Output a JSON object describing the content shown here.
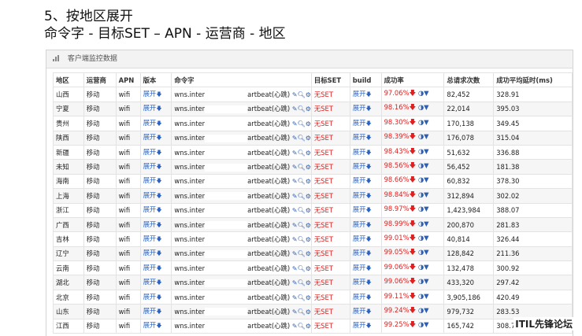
{
  "heading": {
    "line1": "5、按地区展开",
    "line2": "命令字 - 目标SET – APN - 运营商 - 地区"
  },
  "panel": {
    "title": "客户端监控数据"
  },
  "table": {
    "headers": [
      "地区",
      "运营商",
      "APN",
      "版本",
      "命令字",
      "目标SET",
      "build",
      "成功率",
      "总请求次数",
      "成功平均延时(ms)"
    ],
    "rows": [
      {
        "region": "山西",
        "carrier": "移动",
        "apn": "wifi",
        "version": "展开",
        "cmd_prefix": "wns.inter",
        "cmd_suffix": "artbeat(心跳)",
        "target_set": "无SET",
        "build": "展开",
        "rate": "97.06%",
        "total": "82,452",
        "latency": "328.91"
      },
      {
        "region": "宁夏",
        "carrier": "移动",
        "apn": "wifi",
        "version": "展开",
        "cmd_prefix": "wns.inter",
        "cmd_suffix": "artbeat(心跳)",
        "target_set": "无SET",
        "build": "展开",
        "rate": "98.16%",
        "total": "22,014",
        "latency": "395.03"
      },
      {
        "region": "贵州",
        "carrier": "移动",
        "apn": "wifi",
        "version": "展开",
        "cmd_prefix": "wns.inter",
        "cmd_suffix": "artbeat(心跳)",
        "target_set": "无SET",
        "build": "展开",
        "rate": "98.30%",
        "total": "170,138",
        "latency": "349.45"
      },
      {
        "region": "陕西",
        "carrier": "移动",
        "apn": "wifi",
        "version": "展开",
        "cmd_prefix": "wns.inter",
        "cmd_suffix": "artbeat(心跳)",
        "target_set": "无SET",
        "build": "展开",
        "rate": "98.39%",
        "total": "176,078",
        "latency": "315.04"
      },
      {
        "region": "新疆",
        "carrier": "移动",
        "apn": "wifi",
        "version": "展开",
        "cmd_prefix": "wns.inter",
        "cmd_suffix": "artbeat(心跳)",
        "target_set": "无SET",
        "build": "展开",
        "rate": "98.43%",
        "total": "51,632",
        "latency": "336.88"
      },
      {
        "region": "未知",
        "carrier": "移动",
        "apn": "wifi",
        "version": "展开",
        "cmd_prefix": "wns.inter",
        "cmd_suffix": "artbeat(心跳)",
        "target_set": "无SET",
        "build": "展开",
        "rate": "98.56%",
        "total": "56,452",
        "latency": "181.38"
      },
      {
        "region": "海南",
        "carrier": "移动",
        "apn": "wifi",
        "version": "展开",
        "cmd_prefix": "wns.inter",
        "cmd_suffix": "artbeat(心跳)",
        "target_set": "无SET",
        "build": "展开",
        "rate": "98.66%",
        "total": "60,832",
        "latency": "378.30"
      },
      {
        "region": "上海",
        "carrier": "移动",
        "apn": "wifi",
        "version": "展开",
        "cmd_prefix": "wns.inter",
        "cmd_suffix": "artbeat(心跳)",
        "target_set": "无SET",
        "build": "展开",
        "rate": "98.84%",
        "total": "312,894",
        "latency": "302.02"
      },
      {
        "region": "浙江",
        "carrier": "移动",
        "apn": "wifi",
        "version": "展开",
        "cmd_prefix": "wns.inter",
        "cmd_suffix": "artbeat(心跳)",
        "target_set": "无SET",
        "build": "展开",
        "rate": "98.97%",
        "total": "1,423,984",
        "latency": "388.07"
      },
      {
        "region": "广西",
        "carrier": "移动",
        "apn": "wifi",
        "version": "展开",
        "cmd_prefix": "wns.inter",
        "cmd_suffix": "artbeat(心跳)",
        "target_set": "无SET",
        "build": "展开",
        "rate": "98.99%",
        "total": "200,870",
        "latency": "281.83"
      },
      {
        "region": "吉林",
        "carrier": "移动",
        "apn": "wifi",
        "version": "展开",
        "cmd_prefix": "wns.inter",
        "cmd_suffix": "artbeat(心跳)",
        "target_set": "无SET",
        "build": "展开",
        "rate": "99.01%",
        "total": "40,814",
        "latency": "326.44"
      },
      {
        "region": "辽宁",
        "carrier": "移动",
        "apn": "wifi",
        "version": "展开",
        "cmd_prefix": "wns.inter",
        "cmd_suffix": "artbeat(心跳)",
        "target_set": "无SET",
        "build": "展开",
        "rate": "99.05%",
        "total": "128,842",
        "latency": "211.36"
      },
      {
        "region": "云南",
        "carrier": "移动",
        "apn": "wifi",
        "version": "展开",
        "cmd_prefix": "wns.inter",
        "cmd_suffix": "artbeat(心跳)",
        "target_set": "无SET",
        "build": "展开",
        "rate": "99.06%",
        "total": "132,478",
        "latency": "300.92"
      },
      {
        "region": "湖北",
        "carrier": "移动",
        "apn": "wifi",
        "version": "展开",
        "cmd_prefix": "wns.inter",
        "cmd_suffix": "artbeat(心跳)",
        "target_set": "无SET",
        "build": "展开",
        "rate": "99.06%",
        "total": "433,320",
        "latency": "297.42"
      },
      {
        "region": "北京",
        "carrier": "移动",
        "apn": "wifi",
        "version": "展开",
        "cmd_prefix": "wns.inter",
        "cmd_suffix": "artbeat(心跳)",
        "target_set": "无SET",
        "build": "展开",
        "rate": "99.11%",
        "total": "3,905,186",
        "latency": "420.49"
      },
      {
        "region": "山东",
        "carrier": "移动",
        "apn": "wifi",
        "version": "展开",
        "cmd_prefix": "wns.inter",
        "cmd_suffix": "artbeat(心跳)",
        "target_set": "无SET",
        "build": "展开",
        "rate": "99.24%",
        "total": "979,732",
        "latency": "283.53"
      },
      {
        "region": "江西",
        "carrier": "移动",
        "apn": "wifi",
        "version": "展开",
        "cmd_prefix": "wns.inter",
        "cmd_suffix": "artbeat(心跳)",
        "target_set": "无SET",
        "build": "展开",
        "rate": "99.25%",
        "total": "165,742",
        "latency": "308.79"
      }
    ]
  },
  "watermark": "ITIL先锋论坛",
  "colors": {
    "link": "#2a63c6",
    "alert": "#e02020"
  }
}
